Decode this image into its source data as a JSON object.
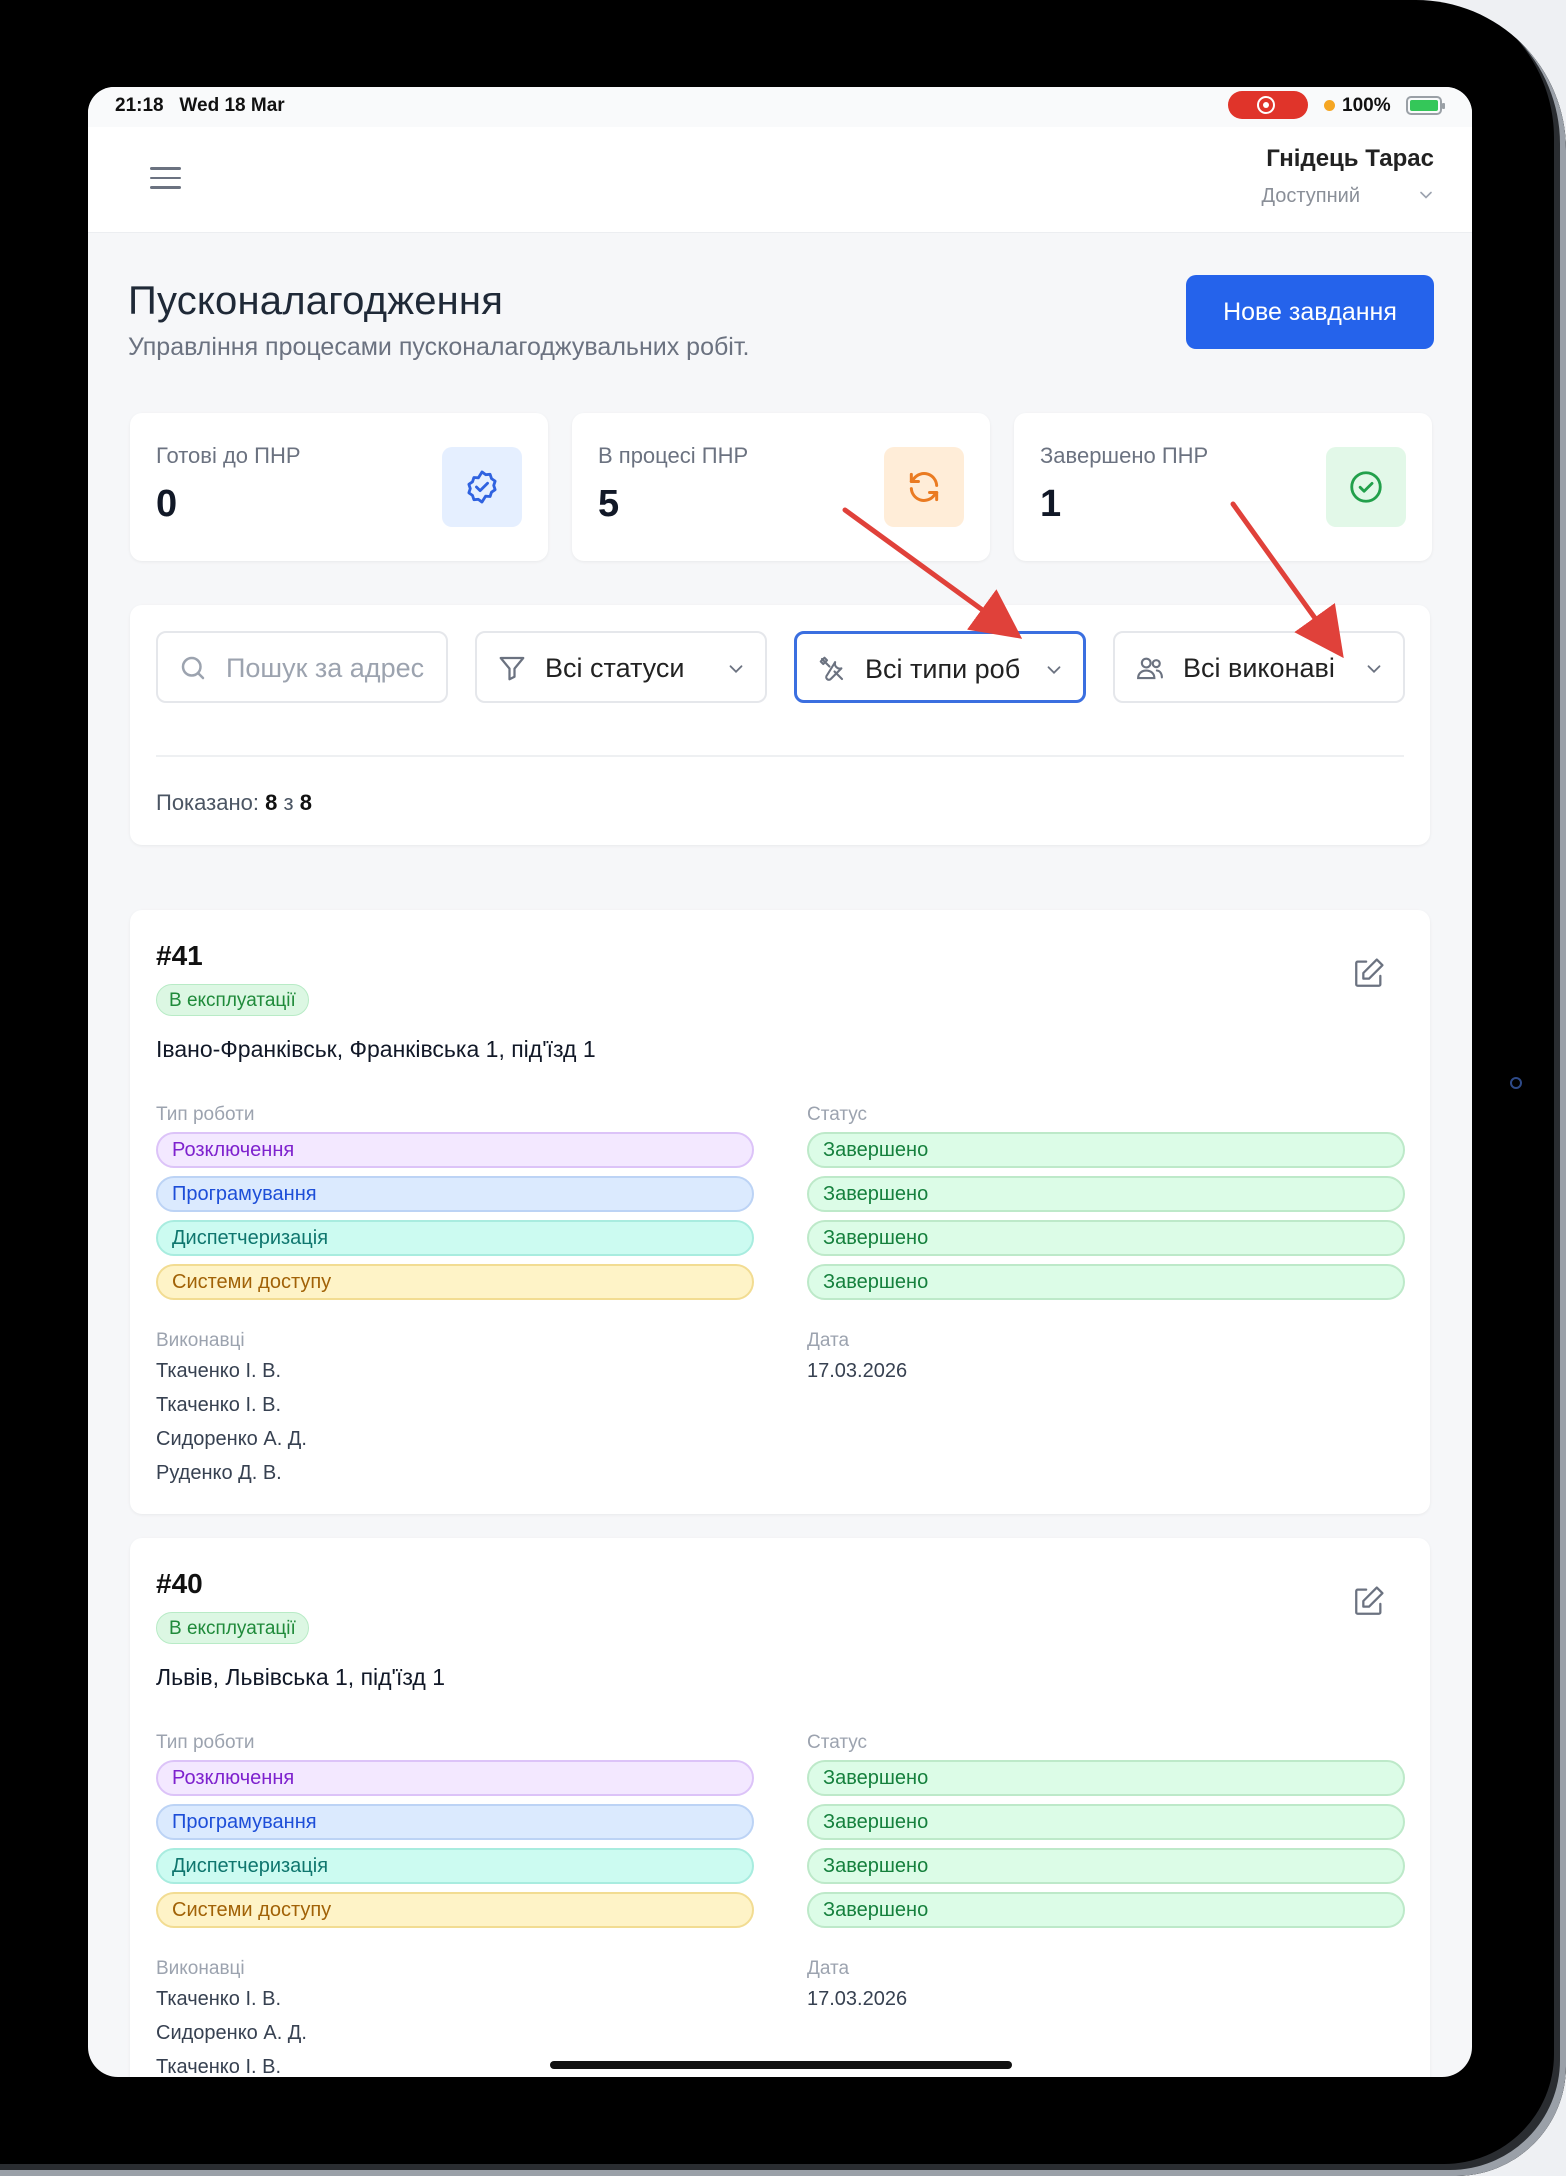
{
  "status_bar": {
    "time_date": "21:18   Wed 18 Mar",
    "battery": "100%"
  },
  "header": {
    "user_name": "Гнідець Тарас",
    "user_status": "Доступний"
  },
  "page": {
    "title": "Пусконалагодження",
    "subtitle": "Управління процесами пусконалагоджувальних робіт.",
    "new_task_label": "Нове завдання"
  },
  "stats": [
    {
      "label": "Готові до ПНР",
      "value": "0",
      "icon": "badge-check-icon",
      "bg": "#e5efff",
      "color": "#2f62e0"
    },
    {
      "label": "В процесі ПНР",
      "value": "5",
      "icon": "refresh-icon",
      "bg": "#ffedd8",
      "color": "#ea7b22"
    },
    {
      "label": "Завершено ПНР",
      "value": "1",
      "icon": "check-circle-icon",
      "bg": "#e2f8e8",
      "color": "#22a04b"
    }
  ],
  "filters": {
    "search_placeholder": "Пошук за адрес",
    "status_value": "Всі статуси",
    "work_type_value": "Всі типи роб",
    "executor_value": "Всі виконаві",
    "shown_prefix": "Показано:",
    "shown_count": "8",
    "shown_sep": "з",
    "shown_total": "8"
  },
  "labels": {
    "work_type": "Тип роботи",
    "status": "Статус",
    "executors": "Виконавці",
    "date": "Дата"
  },
  "tasks": [
    {
      "id": "#41",
      "badge": "В експлуатації",
      "address": "Івано-Франківськ, Франківська 1, під'їзд 1",
      "work_types": [
        "Розключення",
        "Програмування",
        "Диспетчеризація",
        "Системи доступу"
      ],
      "statuses": [
        "Завершено",
        "Завершено",
        "Завершено",
        "Завершено"
      ],
      "executors": [
        "Ткаченко І. В.",
        "Ткаченко І. В.",
        "Сидоренко А. Д.",
        "Руденко Д. В."
      ],
      "date": "17.03.2026"
    },
    {
      "id": "#40",
      "badge": "В експлуатації",
      "address": "Львів, Львівська 1, під'їзд 1",
      "work_types": [
        "Розключення",
        "Програмування",
        "Диспетчеризація",
        "Системи доступу"
      ],
      "statuses": [
        "Завершено",
        "Завершено",
        "Завершено",
        "Завершено"
      ],
      "executors": [
        "Ткаченко І. В.",
        "Сидоренко А. Д.",
        "Ткаченко І. В."
      ],
      "date": "17.03.2026"
    }
  ],
  "annotation_color": "#e0413a"
}
